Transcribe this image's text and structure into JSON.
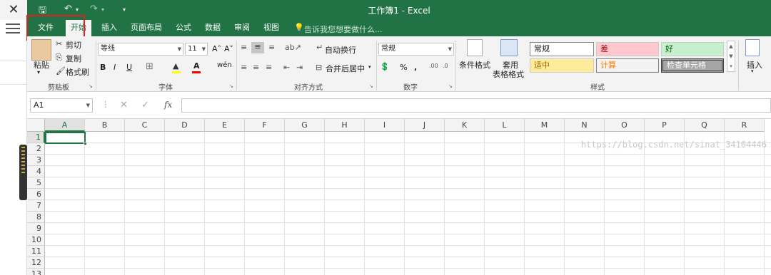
{
  "window": {
    "title": "工作簿1 - Excel",
    "close_glyph": "✕"
  },
  "qat": {
    "save": "🖫",
    "undo": "↶",
    "redo": "↷",
    "more": "▾"
  },
  "tabs": [
    "文件",
    "开始",
    "插入",
    "页面布局",
    "公式",
    "数据",
    "审阅",
    "视图"
  ],
  "active_tab": "开始",
  "tell_me": "告诉我您想要做什么...",
  "clipboard": {
    "paste": "粘贴",
    "cut": "剪切",
    "copy": "复制",
    "format_painter": "格式刷",
    "label": "剪贴板"
  },
  "font": {
    "name": "等线",
    "size": "11",
    "grow": "A˄",
    "shrink": "A˅",
    "bold": "B",
    "italic": "I",
    "underline": "U",
    "phonetic": "wén",
    "label": "字体"
  },
  "alignment": {
    "wrap": "自动换行",
    "merge": "合并后居中",
    "label": "对齐方式"
  },
  "number": {
    "format": "常规",
    "percent": "%",
    "comma": ",",
    "label": "数字"
  },
  "styles": {
    "conditional": "条件格式",
    "table_format_1": "套用",
    "table_format_2": "表格格式",
    "normal": "常规",
    "bad": "差",
    "good": "好",
    "neutral": "适中",
    "calculation": "计算",
    "check_cell": "检查单元格",
    "label": "样式"
  },
  "cells": {
    "insert": "插入"
  },
  "formula_bar": {
    "name_box": "A1",
    "cancel": "✕",
    "enter": "✓",
    "fx": "fx",
    "value": ""
  },
  "columns": [
    "A",
    "B",
    "C",
    "D",
    "E",
    "F",
    "G",
    "H",
    "I",
    "J",
    "K",
    "L",
    "M",
    "N",
    "O",
    "P",
    "Q",
    "R"
  ],
  "rows": [
    "1",
    "2",
    "3",
    "4",
    "5",
    "6",
    "7",
    "8",
    "9",
    "10",
    "11",
    "12",
    "13"
  ],
  "selected_cell": "A1",
  "watermark": "https://blog.csdn.net/sinat_34104446",
  "colors": {
    "excel_green": "#217346",
    "bad_bg": "#ffc7ce",
    "good_bg": "#c6efce",
    "neutral_bg": "#ffeb9c",
    "check_bg": "#a5a5a5"
  }
}
